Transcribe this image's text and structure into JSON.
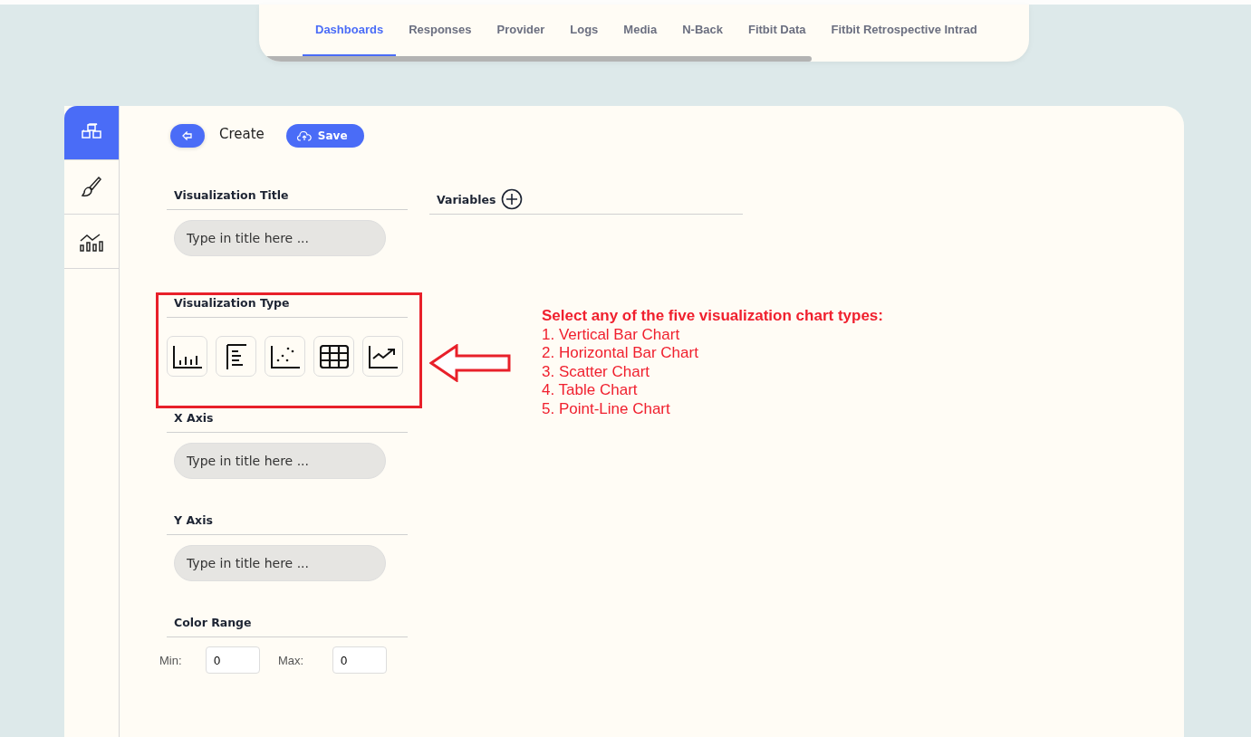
{
  "tabs": [
    {
      "label": "Dashboards",
      "selected": true
    },
    {
      "label": "Responses",
      "selected": false
    },
    {
      "label": "Provider",
      "selected": false
    },
    {
      "label": "Logs",
      "selected": false
    },
    {
      "label": "Media",
      "selected": false
    },
    {
      "label": "N-Back",
      "selected": false
    },
    {
      "label": "Fitbit Data",
      "selected": false
    },
    {
      "label": "Fitbit Retrospective Intrad",
      "selected": false
    }
  ],
  "sidebar": [
    {
      "kind": "cubes",
      "selected": true
    },
    {
      "kind": "brush",
      "selected": false
    },
    {
      "kind": "chart",
      "selected": false
    }
  ],
  "header": {
    "title": "Create",
    "save": "Save"
  },
  "title_section": {
    "label": "Visualization Title",
    "placeholder": "Type in title here ..."
  },
  "variables": {
    "label": "Variables"
  },
  "type_section": {
    "label": "Visualization Type",
    "types": [
      {
        "kind": "vbar"
      },
      {
        "kind": "hbar"
      },
      {
        "kind": "scatter"
      },
      {
        "kind": "table"
      },
      {
        "kind": "line"
      }
    ]
  },
  "x_axis": {
    "label": "X Axis",
    "placeholder": "Type in title here ..."
  },
  "y_axis": {
    "label": "Y Axis",
    "placeholder": "Type in title here ..."
  },
  "color_range": {
    "label": "Color Range",
    "min_label": "Min:",
    "min": "0",
    "max_label": "Max:",
    "max": "0"
  },
  "annotation": {
    "heading": "Select any of the five visualization chart types:",
    "lines": [
      "1. Vertical Bar Chart",
      "2. Horizontal Bar Chart",
      "3. Scatter Chart",
      "4. Table Chart",
      "5. Point-Line Chart"
    ]
  }
}
